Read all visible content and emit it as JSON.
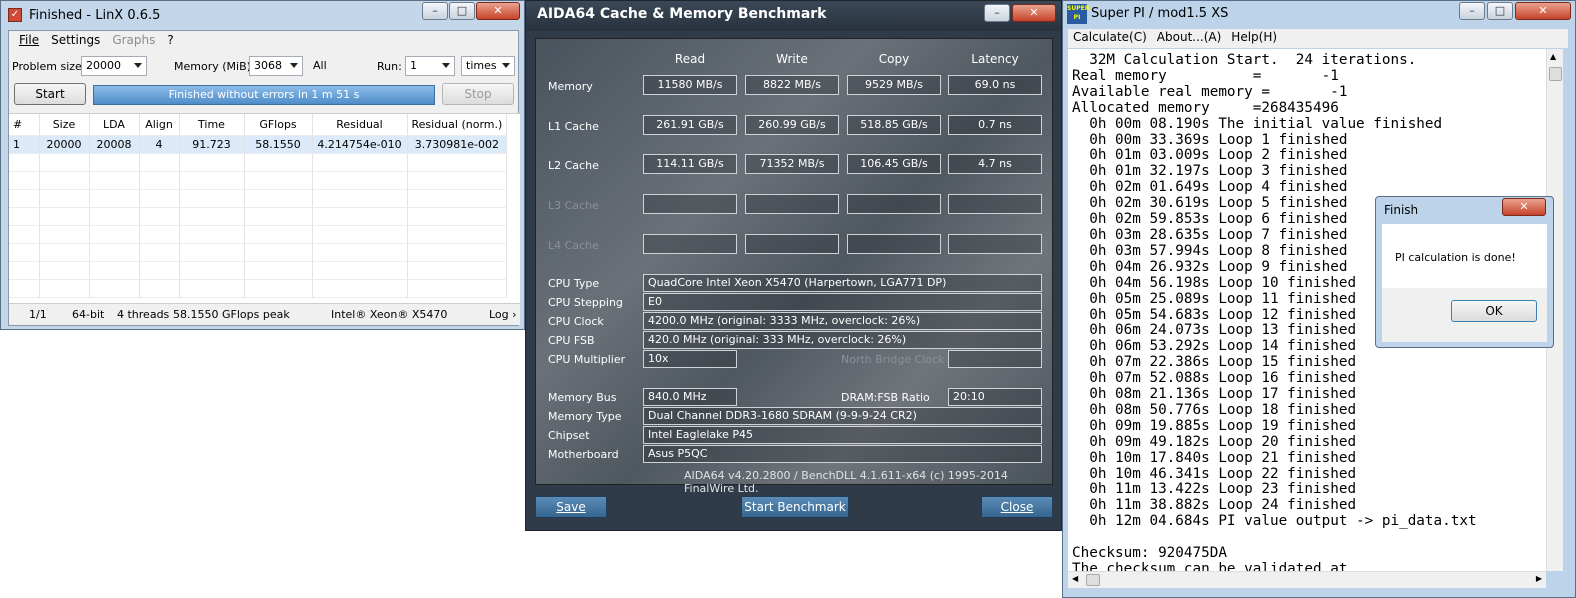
{
  "linx": {
    "title": "Finished - LinX 0.6.5",
    "menu": [
      "File",
      "Settings",
      "Graphs",
      "?"
    ],
    "problem_size_label": "Problem size:",
    "problem_size_value": "20000",
    "memory_label": "Memory (MiB):",
    "memory_value": "3068",
    "all_label": "All",
    "run_label": "Run:",
    "run_value": "1",
    "run_unit": "times",
    "start_label": "Start",
    "status_text": "Finished without errors in 1 m 51 s",
    "stop_label": "Stop",
    "columns": [
      "#",
      "Size",
      "LDA",
      "Align",
      "Time",
      "GFlops",
      "Residual",
      "Residual (norm.)"
    ],
    "rows": [
      [
        "1",
        "20000",
        "20008",
        "4",
        "91.723",
        "58.1550",
        "4.214754e-010",
        "3.730981e-002"
      ]
    ],
    "statusbar": {
      "count": "1/1",
      "bits": "64-bit",
      "threads": "4 threads",
      "peak": "58.1550 GFlops peak",
      "cpu": "Intel® Xeon® X5470",
      "log": "Log ›"
    }
  },
  "aida": {
    "title": "AIDA64 Cache & Memory Benchmark",
    "headers": [
      "Read",
      "Write",
      "Copy",
      "Latency"
    ],
    "bench_rows": [
      {
        "label": "Memory",
        "values": [
          "11580 MB/s",
          "8822 MB/s",
          "9529 MB/s",
          "69.0 ns"
        ],
        "dim": false
      },
      {
        "label": "L1 Cache",
        "values": [
          "261.91 GB/s",
          "260.99 GB/s",
          "518.85 GB/s",
          "0.7 ns"
        ],
        "dim": false
      },
      {
        "label": "L2 Cache",
        "values": [
          "114.11 GB/s",
          "71352 MB/s",
          "106.45 GB/s",
          "4.7 ns"
        ],
        "dim": false
      },
      {
        "label": "L3 Cache",
        "values": [
          "",
          "",
          "",
          ""
        ],
        "dim": true
      },
      {
        "label": "L4 Cache",
        "values": [
          "",
          "",
          "",
          ""
        ],
        "dim": true
      }
    ],
    "cpu_type_label": "CPU Type",
    "cpu_type": "QuadCore Intel Xeon X5470  (Harpertown, LGA771 DP)",
    "cpu_stepping_label": "CPU Stepping",
    "cpu_stepping": "E0",
    "cpu_clock_label": "CPU Clock",
    "cpu_clock": "4200.0 MHz  (original: 3333 MHz, overclock: 26%)",
    "cpu_fsb_label": "CPU FSB",
    "cpu_fsb": "420.0 MHz  (original: 333 MHz, overclock: 26%)",
    "cpu_mult_label": "CPU Multiplier",
    "cpu_mult": "10x",
    "nb_clock_label": "North Bridge Clock",
    "nb_clock": "",
    "mem_bus_label": "Memory Bus",
    "mem_bus": "840.0 MHz",
    "dram_ratio_label": "DRAM:FSB Ratio",
    "dram_ratio": "20:10",
    "mem_type_label": "Memory Type",
    "mem_type": "Dual Channel DDR3-1680 SDRAM  (9-9-9-24 CR2)",
    "chipset_label": "Chipset",
    "chipset": "Intel Eaglelake P45",
    "motherboard_label": "Motherboard",
    "motherboard": "Asus P5QC",
    "footer": "AIDA64 v4.20.2800 / BenchDLL 4.1.611-x64  (c) 1995-2014 FinalWire Ltd.",
    "save_label": "Save",
    "start_label": "Start Benchmark",
    "close_label": "Close"
  },
  "superpi": {
    "title": "Super PI / mod1.5 XS",
    "logo_text": "SUPER PI",
    "menu": [
      "Calculate(C)",
      "About...(A)",
      "Help(H)"
    ],
    "lines": [
      "  32M Calculation Start.  24 iterations.",
      "Real memory          =       -1",
      "Available real memory =       -1",
      "Allocated memory     =268435496",
      "  0h 00m 08.190s The initial value finished",
      "  0h 00m 33.369s Loop 1 finished",
      "  0h 01m 03.009s Loop 2 finished",
      "  0h 01m 32.197s Loop 3 finished",
      "  0h 02m 01.649s Loop 4 finished",
      "  0h 02m 30.619s Loop 5 finished",
      "  0h 02m 59.853s Loop 6 finished",
      "  0h 03m 28.635s Loop 7 finished",
      "  0h 03m 57.994s Loop 8 finished",
      "  0h 04m 26.932s Loop 9 finished",
      "  0h 04m 56.198s Loop 10 finished",
      "  0h 05m 25.089s Loop 11 finished",
      "  0h 05m 54.683s Loop 12 finished",
      "  0h 06m 24.073s Loop 13 finished",
      "  0h 06m 53.292s Loop 14 finished",
      "  0h 07m 22.386s Loop 15 finished",
      "  0h 07m 52.088s Loop 16 finished",
      "  0h 08m 21.136s Loop 17 finished",
      "  0h 08m 50.776s Loop 18 finished",
      "  0h 09m 19.885s Loop 19 finished",
      "  0h 09m 49.182s Loop 20 finished",
      "  0h 10m 17.840s Loop 21 finished",
      "  0h 10m 46.341s Loop 22 finished",
      "  0h 11m 13.422s Loop 23 finished",
      "  0h 11m 38.882s Loop 24 finished",
      "  0h 12m 04.684s PI value output -> pi_data.txt",
      "",
      "Checksum: 920475DA",
      "The checksum can be validated at"
    ]
  },
  "finish_dialog": {
    "title": "Finish",
    "message": "PI calculation is done!",
    "ok_label": "OK"
  }
}
